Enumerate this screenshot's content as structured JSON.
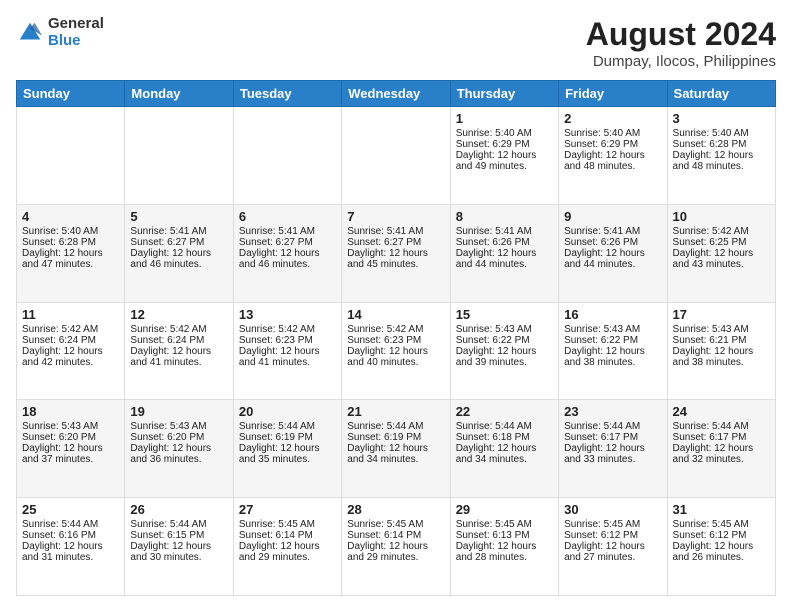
{
  "header": {
    "logo_line1": "General",
    "logo_line2": "Blue",
    "title": "August 2024",
    "subtitle": "Dumpay, Ilocos, Philippines"
  },
  "days_of_week": [
    "Sunday",
    "Monday",
    "Tuesday",
    "Wednesday",
    "Thursday",
    "Friday",
    "Saturday"
  ],
  "weeks": [
    [
      {
        "day": "",
        "info": ""
      },
      {
        "day": "",
        "info": ""
      },
      {
        "day": "",
        "info": ""
      },
      {
        "day": "",
        "info": ""
      },
      {
        "day": "1",
        "info": "Sunrise: 5:40 AM\nSunset: 6:29 PM\nDaylight: 12 hours and 49 minutes."
      },
      {
        "day": "2",
        "info": "Sunrise: 5:40 AM\nSunset: 6:29 PM\nDaylight: 12 hours and 48 minutes."
      },
      {
        "day": "3",
        "info": "Sunrise: 5:40 AM\nSunset: 6:28 PM\nDaylight: 12 hours and 48 minutes."
      }
    ],
    [
      {
        "day": "4",
        "info": "Sunrise: 5:40 AM\nSunset: 6:28 PM\nDaylight: 12 hours and 47 minutes."
      },
      {
        "day": "5",
        "info": "Sunrise: 5:41 AM\nSunset: 6:27 PM\nDaylight: 12 hours and 46 minutes."
      },
      {
        "day": "6",
        "info": "Sunrise: 5:41 AM\nSunset: 6:27 PM\nDaylight: 12 hours and 46 minutes."
      },
      {
        "day": "7",
        "info": "Sunrise: 5:41 AM\nSunset: 6:27 PM\nDaylight: 12 hours and 45 minutes."
      },
      {
        "day": "8",
        "info": "Sunrise: 5:41 AM\nSunset: 6:26 PM\nDaylight: 12 hours and 44 minutes."
      },
      {
        "day": "9",
        "info": "Sunrise: 5:41 AM\nSunset: 6:26 PM\nDaylight: 12 hours and 44 minutes."
      },
      {
        "day": "10",
        "info": "Sunrise: 5:42 AM\nSunset: 6:25 PM\nDaylight: 12 hours and 43 minutes."
      }
    ],
    [
      {
        "day": "11",
        "info": "Sunrise: 5:42 AM\nSunset: 6:24 PM\nDaylight: 12 hours and 42 minutes."
      },
      {
        "day": "12",
        "info": "Sunrise: 5:42 AM\nSunset: 6:24 PM\nDaylight: 12 hours and 41 minutes."
      },
      {
        "day": "13",
        "info": "Sunrise: 5:42 AM\nSunset: 6:23 PM\nDaylight: 12 hours and 41 minutes."
      },
      {
        "day": "14",
        "info": "Sunrise: 5:42 AM\nSunset: 6:23 PM\nDaylight: 12 hours and 40 minutes."
      },
      {
        "day": "15",
        "info": "Sunrise: 5:43 AM\nSunset: 6:22 PM\nDaylight: 12 hours and 39 minutes."
      },
      {
        "day": "16",
        "info": "Sunrise: 5:43 AM\nSunset: 6:22 PM\nDaylight: 12 hours and 38 minutes."
      },
      {
        "day": "17",
        "info": "Sunrise: 5:43 AM\nSunset: 6:21 PM\nDaylight: 12 hours and 38 minutes."
      }
    ],
    [
      {
        "day": "18",
        "info": "Sunrise: 5:43 AM\nSunset: 6:20 PM\nDaylight: 12 hours and 37 minutes."
      },
      {
        "day": "19",
        "info": "Sunrise: 5:43 AM\nSunset: 6:20 PM\nDaylight: 12 hours and 36 minutes."
      },
      {
        "day": "20",
        "info": "Sunrise: 5:44 AM\nSunset: 6:19 PM\nDaylight: 12 hours and 35 minutes."
      },
      {
        "day": "21",
        "info": "Sunrise: 5:44 AM\nSunset: 6:19 PM\nDaylight: 12 hours and 34 minutes."
      },
      {
        "day": "22",
        "info": "Sunrise: 5:44 AM\nSunset: 6:18 PM\nDaylight: 12 hours and 34 minutes."
      },
      {
        "day": "23",
        "info": "Sunrise: 5:44 AM\nSunset: 6:17 PM\nDaylight: 12 hours and 33 minutes."
      },
      {
        "day": "24",
        "info": "Sunrise: 5:44 AM\nSunset: 6:17 PM\nDaylight: 12 hours and 32 minutes."
      }
    ],
    [
      {
        "day": "25",
        "info": "Sunrise: 5:44 AM\nSunset: 6:16 PM\nDaylight: 12 hours and 31 minutes."
      },
      {
        "day": "26",
        "info": "Sunrise: 5:44 AM\nSunset: 6:15 PM\nDaylight: 12 hours and 30 minutes."
      },
      {
        "day": "27",
        "info": "Sunrise: 5:45 AM\nSunset: 6:14 PM\nDaylight: 12 hours and 29 minutes."
      },
      {
        "day": "28",
        "info": "Sunrise: 5:45 AM\nSunset: 6:14 PM\nDaylight: 12 hours and 29 minutes."
      },
      {
        "day": "29",
        "info": "Sunrise: 5:45 AM\nSunset: 6:13 PM\nDaylight: 12 hours and 28 minutes."
      },
      {
        "day": "30",
        "info": "Sunrise: 5:45 AM\nSunset: 6:12 PM\nDaylight: 12 hours and 27 minutes."
      },
      {
        "day": "31",
        "info": "Sunrise: 5:45 AM\nSunset: 6:12 PM\nDaylight: 12 hours and 26 minutes."
      }
    ]
  ]
}
